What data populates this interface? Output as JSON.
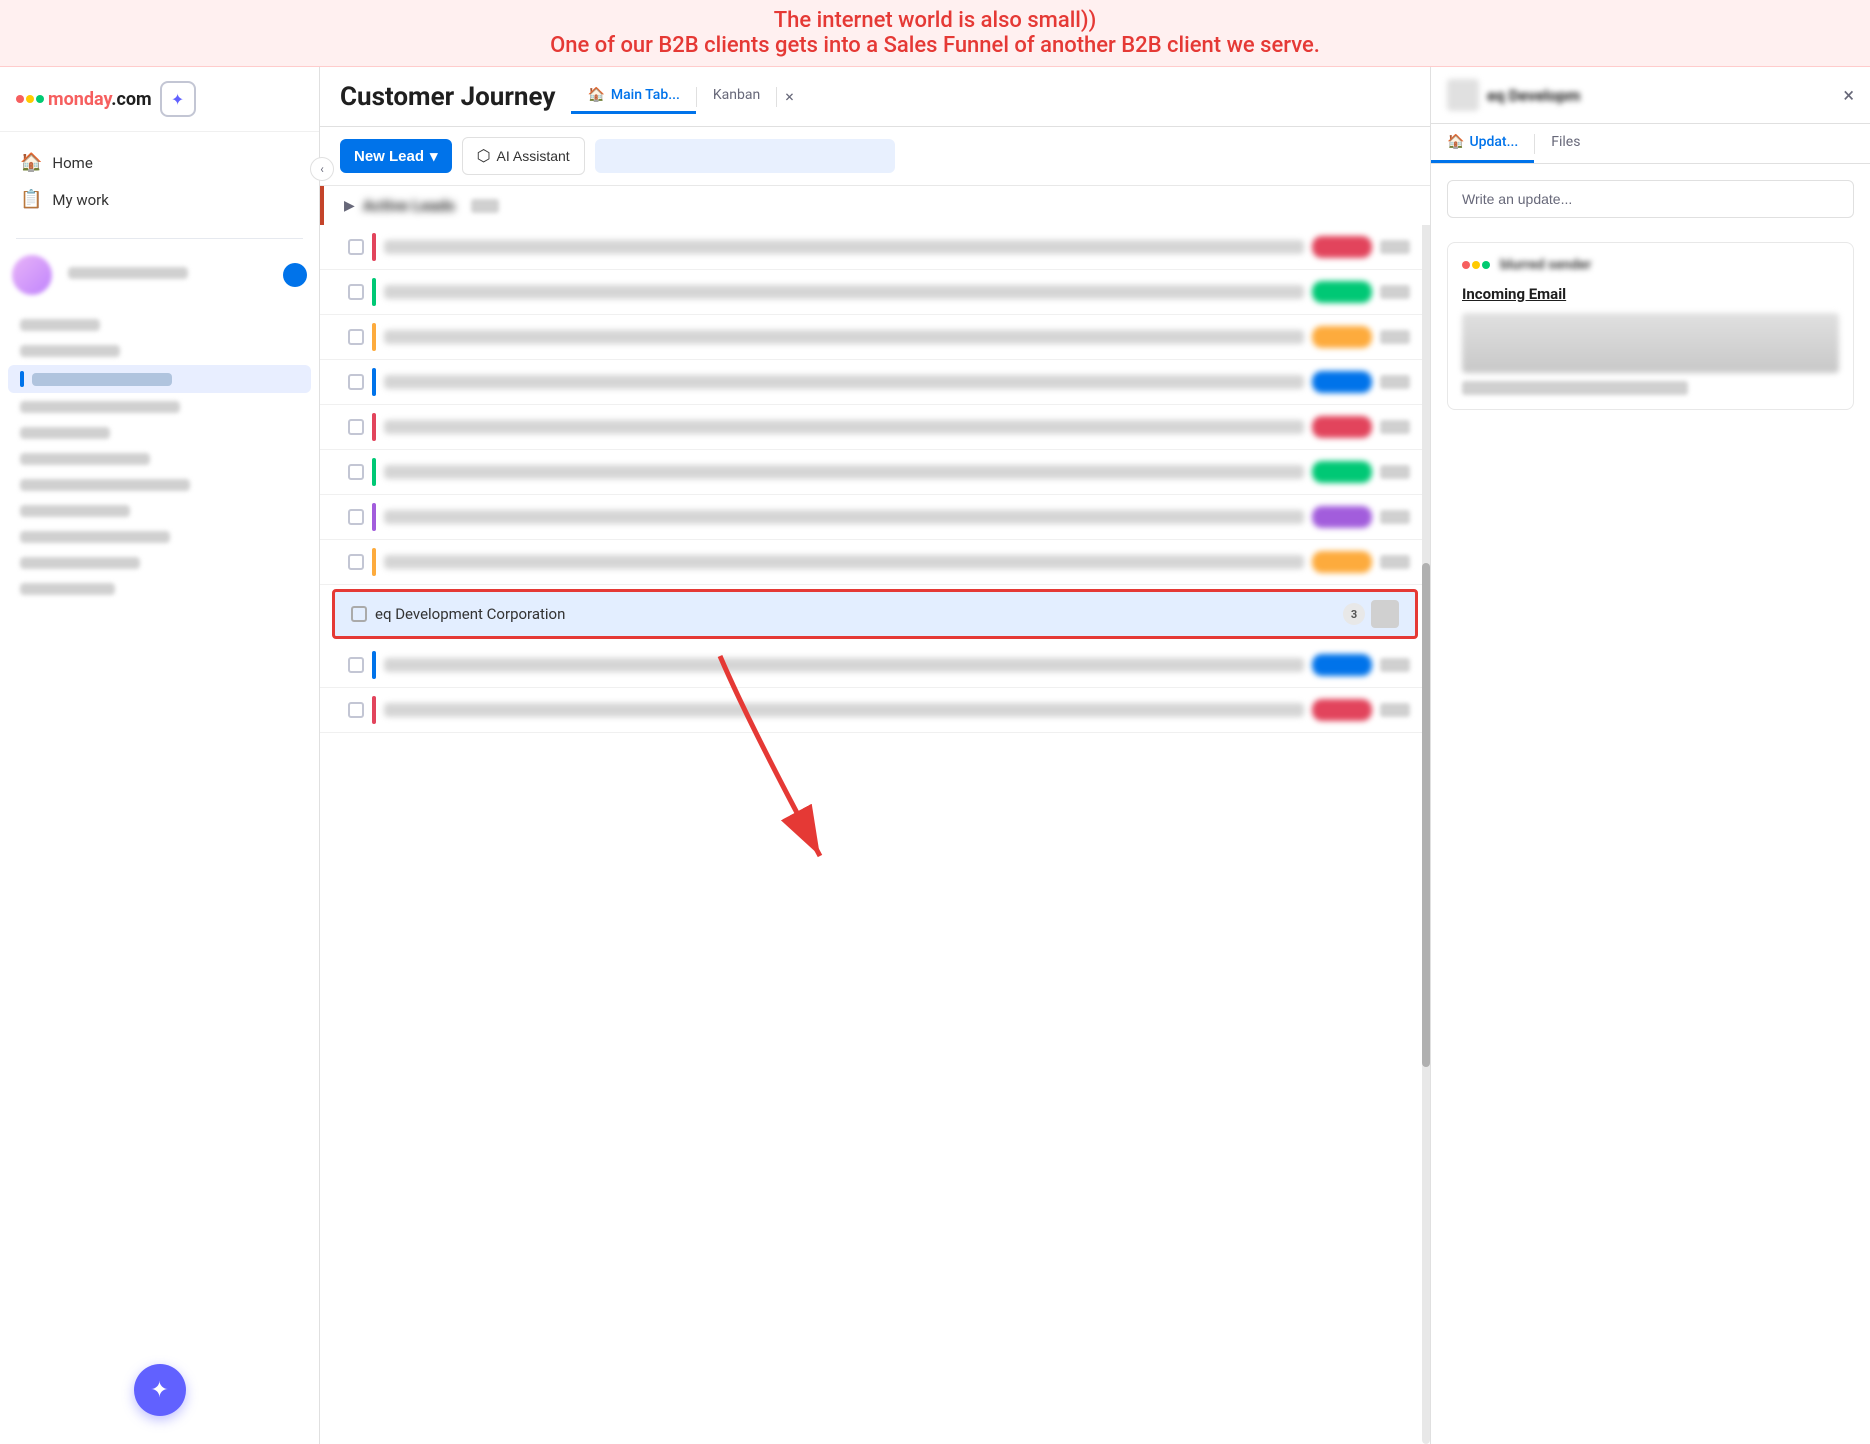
{
  "banner": {
    "line1": "The internet world is also small))",
    "line2": "One of our B2B clients gets into a Sales Funnel of another B2B client we serve."
  },
  "sidebar": {
    "logo_text": "monday",
    "logo_suffix": ".com",
    "nav_items": [
      {
        "id": "home",
        "label": "Home",
        "icon": "🏠"
      },
      {
        "id": "my_work",
        "label": "My work",
        "icon": "📋"
      }
    ],
    "bottom_btn_label": "✦"
  },
  "header": {
    "page_title": "Customer Journey",
    "tabs": [
      {
        "id": "main_tab",
        "label": "Main Tab...",
        "icon": "🏠",
        "active": true
      },
      {
        "id": "kanban",
        "label": "Kanban",
        "active": false
      }
    ],
    "close_label": "×"
  },
  "toolbar": {
    "new_lead_label": "New Lead",
    "dropdown_arrow": "▾",
    "ai_assistant_label": "AI Assistant",
    "search_placeholder": ""
  },
  "board": {
    "group_title": "Active Leads",
    "rows": [
      {
        "id": 1,
        "color": "#e2445c",
        "blurred": true
      },
      {
        "id": 2,
        "color": "#00c875",
        "blurred": true
      },
      {
        "id": 3,
        "color": "#fdab3d",
        "blurred": true
      },
      {
        "id": 4,
        "color": "#0073ea",
        "blurred": true
      },
      {
        "id": 5,
        "color": "#e2445c",
        "blurred": true
      },
      {
        "id": 6,
        "color": "#00c875",
        "blurred": true
      },
      {
        "id": 7,
        "color": "#a25ddc",
        "blurred": true
      },
      {
        "id": 8,
        "color": "#fdab3d",
        "blurred": true
      },
      {
        "id": 9,
        "color": "#e2445c",
        "blurred": true
      }
    ],
    "highlighted_row": {
      "label": "eq Development Corporation",
      "badge": "3",
      "color": "#0073ea"
    }
  },
  "right_panel": {
    "title": "eq Developm",
    "close_label": "×",
    "tabs": [
      {
        "id": "updates",
        "label": "Updat...",
        "icon": "🏠",
        "active": true
      },
      {
        "id": "files",
        "label": "Files",
        "active": false
      }
    ],
    "write_update_placeholder": "Write an update...",
    "email_card": {
      "subject": "Incoming Email",
      "sender": "blurred sender"
    }
  }
}
